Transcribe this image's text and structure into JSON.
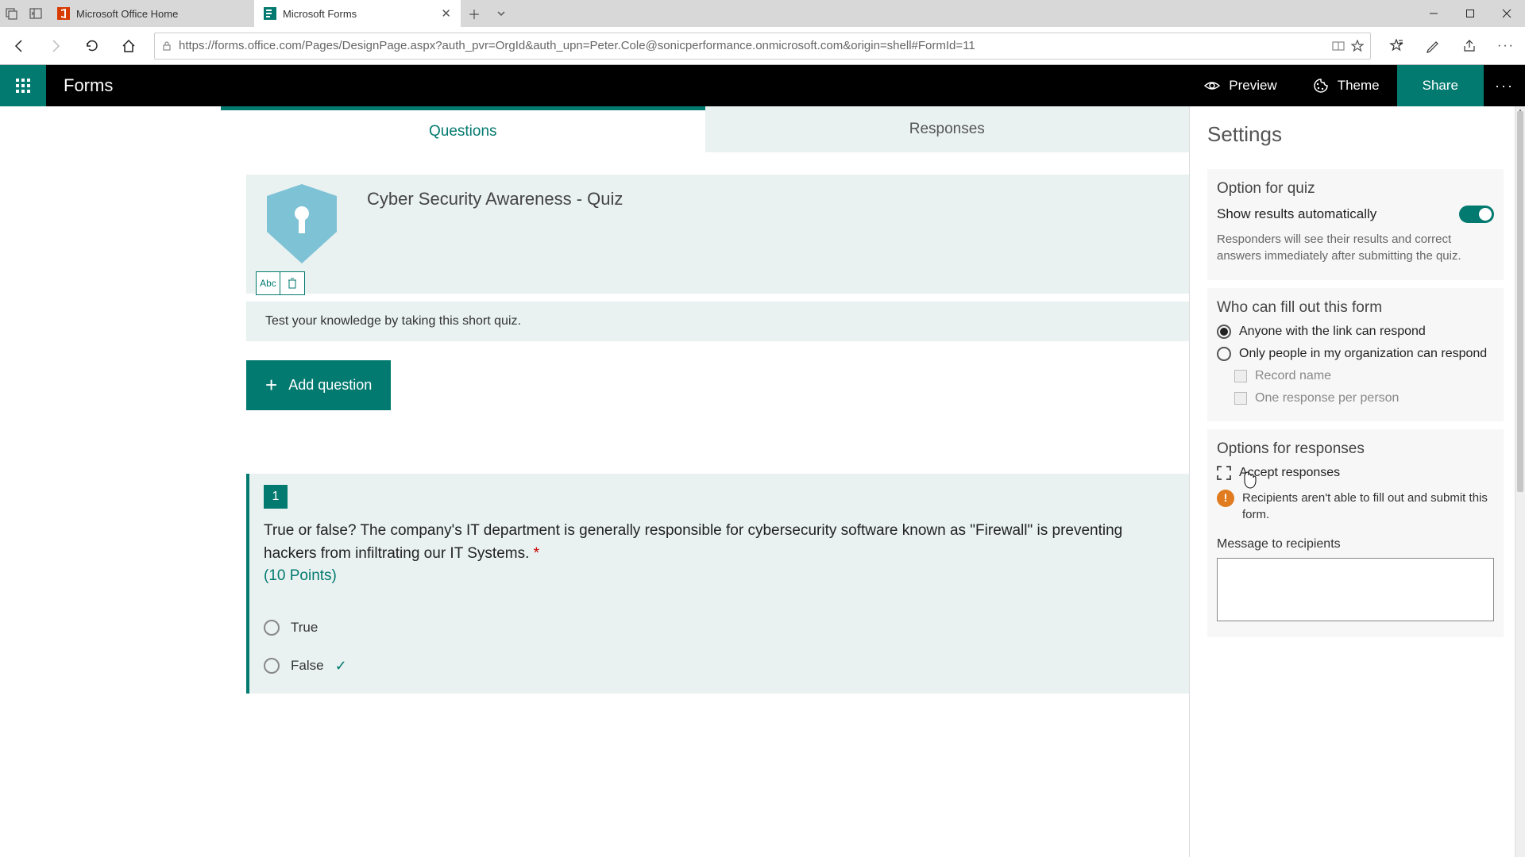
{
  "browser": {
    "tabs": [
      {
        "title": "Microsoft Office Home",
        "active": false
      },
      {
        "title": "Microsoft Forms",
        "active": true
      }
    ],
    "url": "https://forms.office.com/Pages/DesignPage.aspx?auth_pvr=OrgId&auth_upn=Peter.Cole@sonicperformance.onmicrosoft.com&origin=shell#FormId=11"
  },
  "app": {
    "name": "Forms",
    "preview": "Preview",
    "theme": "Theme",
    "share": "Share"
  },
  "main_tabs": {
    "questions": "Questions",
    "responses": "Responses"
  },
  "form": {
    "title": "Cyber Security Awareness - Quiz",
    "description": "Test your knowledge by taking this short quiz.",
    "add_question": "Add question"
  },
  "question1": {
    "number": "1",
    "text": "True or false? The company's IT department is generally responsible for cybersecurity software known as \"Firewall\" is preventing hackers from infiltrating our IT Systems.",
    "required_marker": "*",
    "points": "(10 Points)",
    "answers": {
      "true": "True",
      "false": "False"
    }
  },
  "settings": {
    "title": "Settings",
    "quiz": {
      "heading": "Option for quiz",
      "show_results": "Show results automatically",
      "hint": "Responders will see their results and correct answers immediately after submitting the quiz."
    },
    "who": {
      "heading": "Who can fill out this form",
      "anyone": "Anyone with the link can respond",
      "org": "Only people in my organization can respond",
      "record_name": "Record name",
      "one_response": "One response per person"
    },
    "responses": {
      "heading": "Options for responses",
      "accept": "Accept responses",
      "warning": "Recipients aren't able to fill out and submit this form.",
      "msg_label": "Message to recipients"
    }
  }
}
